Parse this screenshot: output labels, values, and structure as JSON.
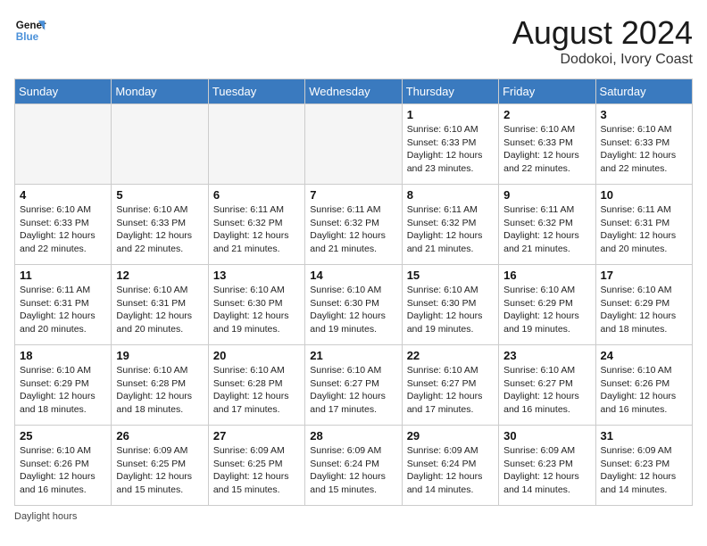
{
  "header": {
    "logo_line1": "General",
    "logo_line2": "Blue",
    "month_title": "August 2024",
    "location": "Dodokoi, Ivory Coast"
  },
  "days_of_week": [
    "Sunday",
    "Monday",
    "Tuesday",
    "Wednesday",
    "Thursday",
    "Friday",
    "Saturday"
  ],
  "footer": {
    "label": "Daylight hours"
  },
  "weeks": [
    [
      {
        "day": "",
        "info": ""
      },
      {
        "day": "",
        "info": ""
      },
      {
        "day": "",
        "info": ""
      },
      {
        "day": "",
        "info": ""
      },
      {
        "day": "1",
        "sunrise": "6:10 AM",
        "sunset": "6:33 PM",
        "daylight": "12 hours and 23 minutes."
      },
      {
        "day": "2",
        "sunrise": "6:10 AM",
        "sunset": "6:33 PM",
        "daylight": "12 hours and 22 minutes."
      },
      {
        "day": "3",
        "sunrise": "6:10 AM",
        "sunset": "6:33 PM",
        "daylight": "12 hours and 22 minutes."
      }
    ],
    [
      {
        "day": "4",
        "sunrise": "6:10 AM",
        "sunset": "6:33 PM",
        "daylight": "12 hours and 22 minutes."
      },
      {
        "day": "5",
        "sunrise": "6:10 AM",
        "sunset": "6:33 PM",
        "daylight": "12 hours and 22 minutes."
      },
      {
        "day": "6",
        "sunrise": "6:11 AM",
        "sunset": "6:32 PM",
        "daylight": "12 hours and 21 minutes."
      },
      {
        "day": "7",
        "sunrise": "6:11 AM",
        "sunset": "6:32 PM",
        "daylight": "12 hours and 21 minutes."
      },
      {
        "day": "8",
        "sunrise": "6:11 AM",
        "sunset": "6:32 PM",
        "daylight": "12 hours and 21 minutes."
      },
      {
        "day": "9",
        "sunrise": "6:11 AM",
        "sunset": "6:32 PM",
        "daylight": "12 hours and 21 minutes."
      },
      {
        "day": "10",
        "sunrise": "6:11 AM",
        "sunset": "6:31 PM",
        "daylight": "12 hours and 20 minutes."
      }
    ],
    [
      {
        "day": "11",
        "sunrise": "6:11 AM",
        "sunset": "6:31 PM",
        "daylight": "12 hours and 20 minutes."
      },
      {
        "day": "12",
        "sunrise": "6:10 AM",
        "sunset": "6:31 PM",
        "daylight": "12 hours and 20 minutes."
      },
      {
        "day": "13",
        "sunrise": "6:10 AM",
        "sunset": "6:30 PM",
        "daylight": "12 hours and 19 minutes."
      },
      {
        "day": "14",
        "sunrise": "6:10 AM",
        "sunset": "6:30 PM",
        "daylight": "12 hours and 19 minutes."
      },
      {
        "day": "15",
        "sunrise": "6:10 AM",
        "sunset": "6:30 PM",
        "daylight": "12 hours and 19 minutes."
      },
      {
        "day": "16",
        "sunrise": "6:10 AM",
        "sunset": "6:29 PM",
        "daylight": "12 hours and 19 minutes."
      },
      {
        "day": "17",
        "sunrise": "6:10 AM",
        "sunset": "6:29 PM",
        "daylight": "12 hours and 18 minutes."
      }
    ],
    [
      {
        "day": "18",
        "sunrise": "6:10 AM",
        "sunset": "6:29 PM",
        "daylight": "12 hours and 18 minutes."
      },
      {
        "day": "19",
        "sunrise": "6:10 AM",
        "sunset": "6:28 PM",
        "daylight": "12 hours and 18 minutes."
      },
      {
        "day": "20",
        "sunrise": "6:10 AM",
        "sunset": "6:28 PM",
        "daylight": "12 hours and 17 minutes."
      },
      {
        "day": "21",
        "sunrise": "6:10 AM",
        "sunset": "6:27 PM",
        "daylight": "12 hours and 17 minutes."
      },
      {
        "day": "22",
        "sunrise": "6:10 AM",
        "sunset": "6:27 PM",
        "daylight": "12 hours and 17 minutes."
      },
      {
        "day": "23",
        "sunrise": "6:10 AM",
        "sunset": "6:27 PM",
        "daylight": "12 hours and 16 minutes."
      },
      {
        "day": "24",
        "sunrise": "6:10 AM",
        "sunset": "6:26 PM",
        "daylight": "12 hours and 16 minutes."
      }
    ],
    [
      {
        "day": "25",
        "sunrise": "6:10 AM",
        "sunset": "6:26 PM",
        "daylight": "12 hours and 16 minutes."
      },
      {
        "day": "26",
        "sunrise": "6:09 AM",
        "sunset": "6:25 PM",
        "daylight": "12 hours and 15 minutes."
      },
      {
        "day": "27",
        "sunrise": "6:09 AM",
        "sunset": "6:25 PM",
        "daylight": "12 hours and 15 minutes."
      },
      {
        "day": "28",
        "sunrise": "6:09 AM",
        "sunset": "6:24 PM",
        "daylight": "12 hours and 15 minutes."
      },
      {
        "day": "29",
        "sunrise": "6:09 AM",
        "sunset": "6:24 PM",
        "daylight": "12 hours and 14 minutes."
      },
      {
        "day": "30",
        "sunrise": "6:09 AM",
        "sunset": "6:23 PM",
        "daylight": "12 hours and 14 minutes."
      },
      {
        "day": "31",
        "sunrise": "6:09 AM",
        "sunset": "6:23 PM",
        "daylight": "12 hours and 14 minutes."
      }
    ]
  ]
}
